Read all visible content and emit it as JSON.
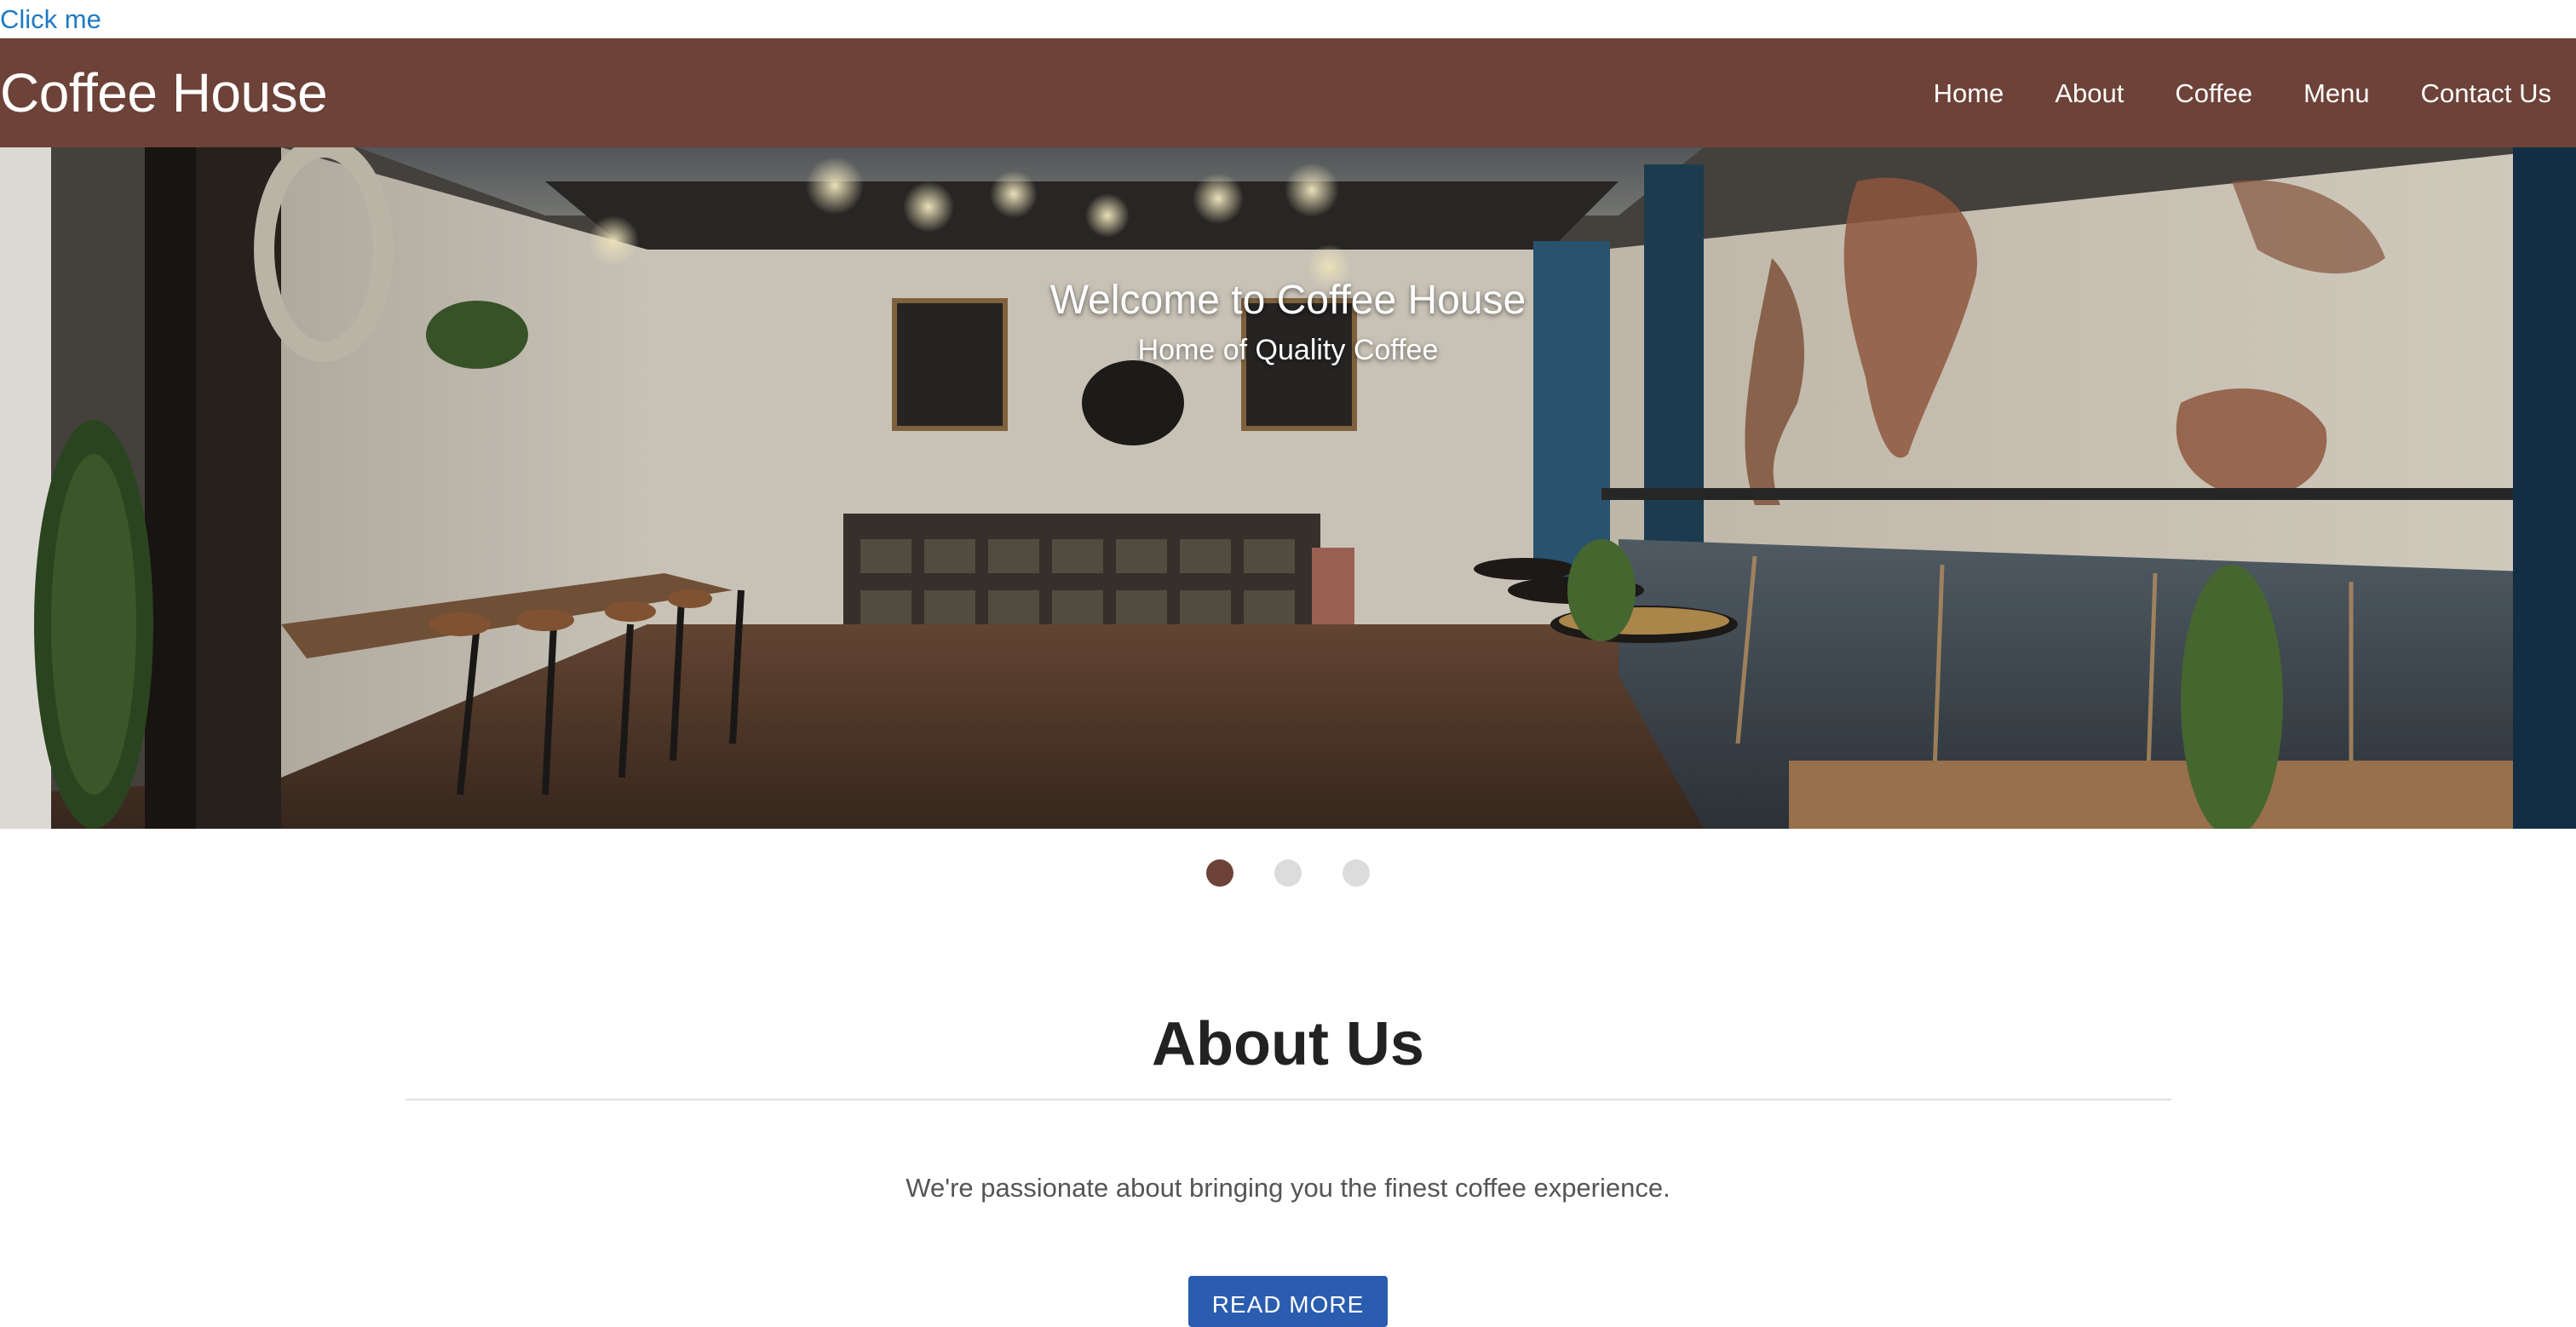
{
  "skip_link": "Click me",
  "navbar": {
    "brand": "Coffee House",
    "links": [
      "Home",
      "About",
      "Coffee",
      "Menu",
      "Contact Us"
    ],
    "background": "#6d4238"
  },
  "hero": {
    "title": "Welcome to Coffee House",
    "subtitle": "Home of Quality Coffee"
  },
  "carousel": {
    "slide_count": 3,
    "active_index": 0,
    "active_color": "#6d4238",
    "inactive_color": "#dcdcdc"
  },
  "about": {
    "title": "About Us",
    "text": "We're passionate about bringing you the finest coffee experience.",
    "button_label": "READ MORE",
    "button_color": "#2a5db0"
  }
}
